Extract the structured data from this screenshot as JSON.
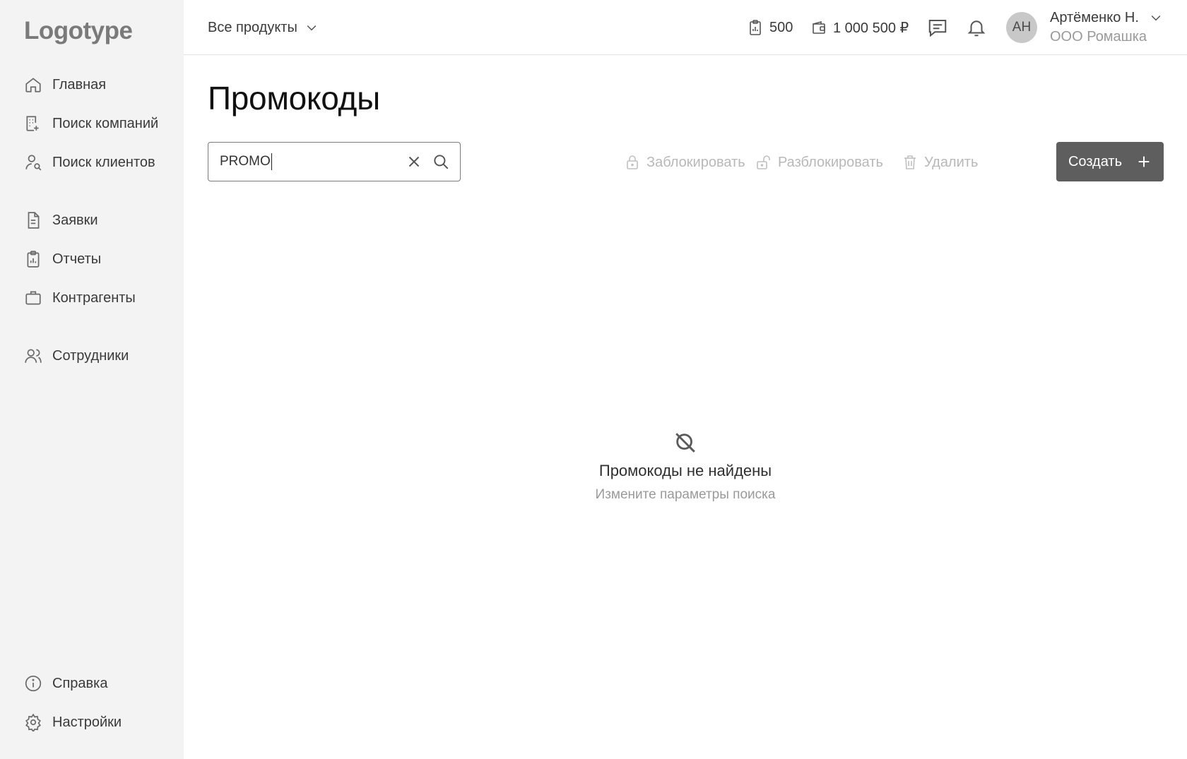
{
  "sidebar": {
    "logo": "Logotype",
    "items": [
      {
        "label": "Главная",
        "icon": "home-icon"
      },
      {
        "label": "Поиск компаний",
        "icon": "building-search-icon"
      },
      {
        "label": "Поиск клиентов",
        "icon": "user-search-icon"
      },
      {
        "label": "Заявки",
        "icon": "document-icon"
      },
      {
        "label": "Отчеты",
        "icon": "report-icon"
      },
      {
        "label": "Контрагенты",
        "icon": "briefcase-icon"
      },
      {
        "label": "Сотрудники",
        "icon": "users-icon"
      }
    ],
    "bottom_items": [
      {
        "label": "Справка",
        "icon": "info-icon"
      },
      {
        "label": "Настройки",
        "icon": "gear-icon"
      }
    ]
  },
  "header": {
    "product_select": "Все продукты",
    "reports_count": "500",
    "balance": "1 000 500 ₽",
    "avatar_initials": "АН",
    "user_name": "Артёменко Н.",
    "user_org": "ООО Ромашка"
  },
  "main": {
    "title": "Промокоды",
    "search": {
      "value": "PROMO"
    },
    "actions": {
      "block": "Заблокировать",
      "unblock": "Разблокировать",
      "delete": "Удалить",
      "create": "Создать"
    },
    "empty_state": {
      "title": "Промокоды не найдены",
      "subtitle": "Измените параметры поиска"
    }
  },
  "colors": {
    "sidebar_bg": "#f3f3f3",
    "primary_button": "#5e5e5e",
    "disabled_text": "#b8b8b8"
  }
}
